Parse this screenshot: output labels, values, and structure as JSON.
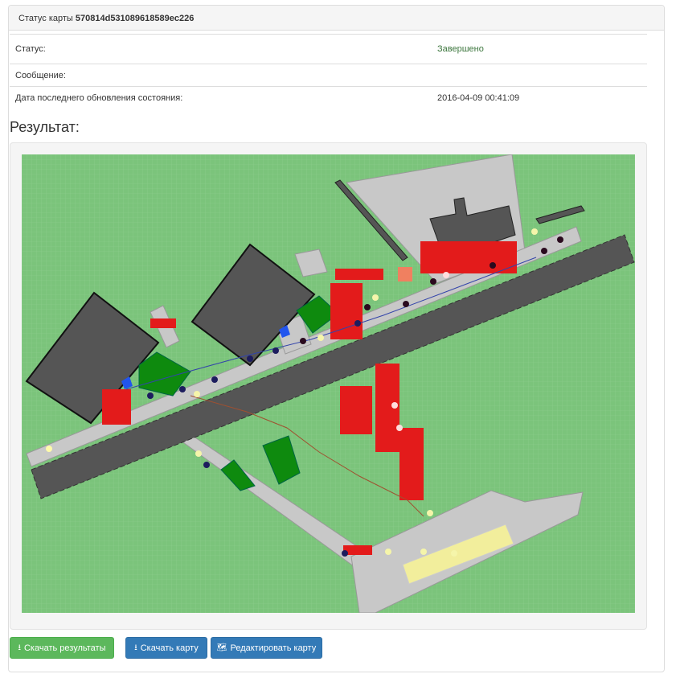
{
  "header": {
    "prefix": "Статус карты",
    "map_id": "570814d531089618589ec226"
  },
  "status": {
    "rows": [
      {
        "label": "Статус:",
        "value": "Завершено"
      },
      {
        "label": "Сообщение:",
        "value": ""
      },
      {
        "label": "Дата последнего обновления состояния:",
        "value": "2016-04-09 00:41:09"
      }
    ]
  },
  "result": {
    "title": "Результат:"
  },
  "colors": {
    "grass": "#7bc47b",
    "pavement": "#c8c8c8",
    "building": "#555555",
    "heat": "#e31b1b",
    "success": "#5cb85c",
    "primary": "#337ab7"
  },
  "buttons": {
    "download_results": "Скачать результаты",
    "download_map": "Скачать карту",
    "edit_map": "Редактировать карту"
  },
  "icons": {
    "download": "download-icon",
    "map": "map-icon"
  }
}
